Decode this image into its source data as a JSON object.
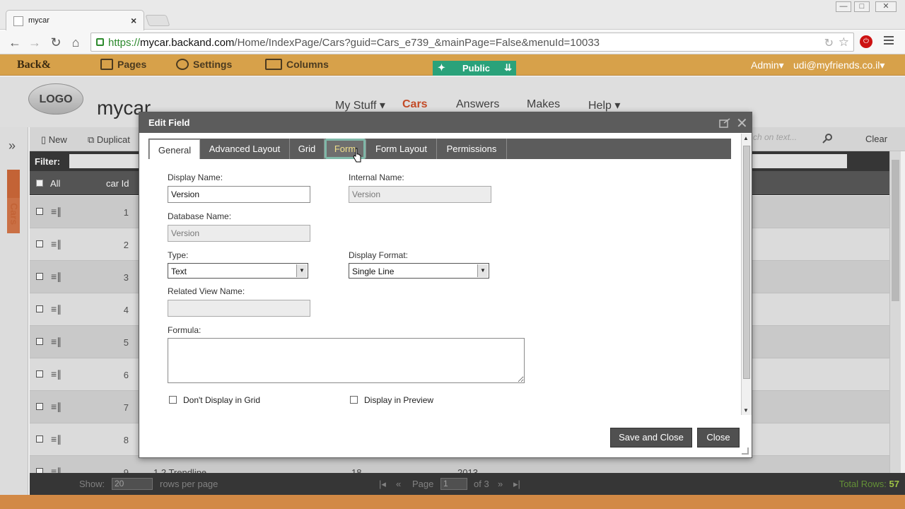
{
  "browser": {
    "tab_title": "mycar",
    "url_protocol": "https://",
    "url_host": "mycar.backand.com",
    "url_path": "/Home/IndexPage/Cars?guid=Cars_e739_&mainPage=False&menuId=10033",
    "window_min": "—",
    "window_max": "□",
    "window_close": "✕"
  },
  "appbar": {
    "brand": "Back&",
    "pages": "Pages",
    "settings": "Settings",
    "columns": "Columns",
    "public": "Public",
    "admin": "Admin▾",
    "user": "udi@myfriends.co.il▾"
  },
  "site": {
    "logo": "LOGO",
    "title": "mycar",
    "nav": [
      {
        "label": "My Stuff ▾"
      },
      {
        "label": "Cars"
      },
      {
        "label": "Answers"
      },
      {
        "label": "Makes"
      },
      {
        "label": "Help ▾"
      }
    ]
  },
  "sidebar": {
    "category": "Cars"
  },
  "grid": {
    "new_label": "New",
    "duplicate_label": "Duplicat",
    "search_placeholder": "ch on text...",
    "clear_label": "Clear",
    "filter_label": "Filter:",
    "all_label": "All",
    "carid_header": "car Id",
    "rows": [
      {
        "id": "1",
        "c2": "",
        "c3": "",
        "c4": ""
      },
      {
        "id": "2",
        "c2": "",
        "c3": "",
        "c4": ""
      },
      {
        "id": "3",
        "c2": "",
        "c3": "",
        "c4": ""
      },
      {
        "id": "4",
        "c2": "",
        "c3": "",
        "c4": ""
      },
      {
        "id": "5",
        "c2": "",
        "c3": "",
        "c4": ""
      },
      {
        "id": "6",
        "c2": "",
        "c3": "",
        "c4": ""
      },
      {
        "id": "7",
        "c2": "",
        "c3": "",
        "c4": ""
      },
      {
        "id": "8",
        "c2": "",
        "c3": "",
        "c4": ""
      },
      {
        "id": "9",
        "c2": "1.2 Trendline",
        "c3": "18",
        "c4": "2013"
      }
    ]
  },
  "footer": {
    "show": "Show:",
    "rows_value": "20",
    "rows_per_page": "rows per page",
    "page": "Page",
    "page_value": "1",
    "of": "of 3",
    "total_label": "Total Rows:",
    "total_value": "57"
  },
  "modal": {
    "title": "Edit Field",
    "tabs": [
      {
        "label": "General"
      },
      {
        "label": "Advanced Layout"
      },
      {
        "label": "Grid"
      },
      {
        "label": "Form"
      },
      {
        "label": "Form Layout"
      },
      {
        "label": "Permissions"
      }
    ],
    "display_name_label": "Display Name:",
    "display_name_value": "Version",
    "internal_name_label": "Internal Name:",
    "internal_name_value": "Version",
    "database_name_label": "Database Name:",
    "database_name_value": "Version",
    "type_label": "Type:",
    "type_value": "Text",
    "display_format_label": "Display Format:",
    "display_format_value": "Single Line",
    "related_view_label": "Related View Name:",
    "related_view_value": "",
    "formula_label": "Formula:",
    "formula_value": "",
    "dont_display_label": "Don't Display in Grid",
    "display_preview_label": "Display in Preview",
    "save_close": "Save and Close",
    "close": "Close"
  },
  "colors": {
    "appbar": "#d7a14a",
    "accent": "#d0502a",
    "public": "#2aa27a"
  }
}
